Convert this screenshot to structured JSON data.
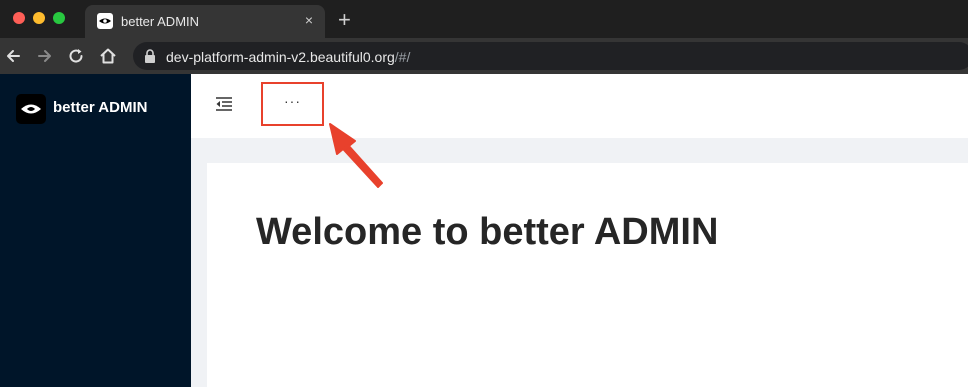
{
  "browser": {
    "tab": {
      "title": "better ADMIN",
      "close_glyph": "×",
      "favicon": "eye-logo-icon"
    },
    "new_tab_glyph": "+",
    "url": {
      "domain": "dev-platform-admin-v2.beautiful0.org",
      "path": "/#/"
    },
    "icons": [
      "back-arrow-icon",
      "forward-arrow-icon",
      "reload-icon",
      "home-icon",
      "lock-icon"
    ]
  },
  "sidebar": {
    "brand": "better ADMIN",
    "logo": "eye-logo-icon"
  },
  "header": {
    "more_label": "···",
    "menu_toggle_icon": "menu-fold-icon"
  },
  "main": {
    "welcome": "Welcome to better ADMIN"
  },
  "colors": {
    "sidebar_bg": "#001529",
    "page_bg": "#f0f2f5",
    "annotation": "#e8412c"
  }
}
